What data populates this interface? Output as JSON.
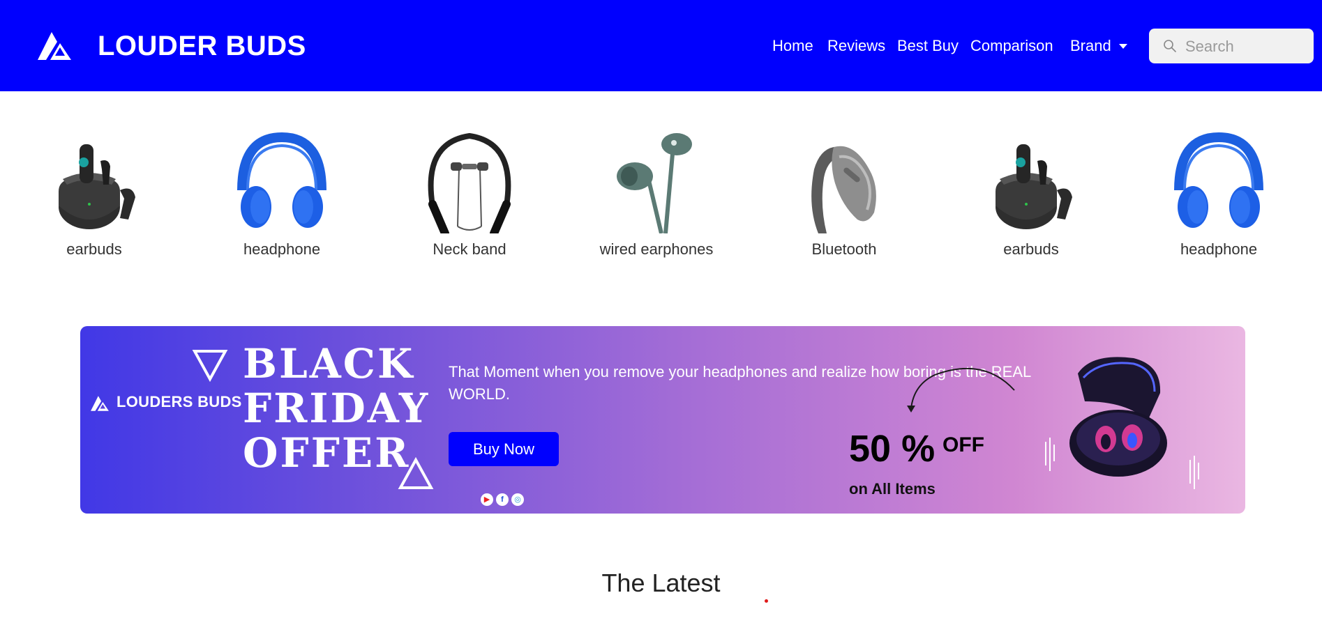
{
  "navbar": {
    "brand": "LOUDER BUDS",
    "links": [
      {
        "label": "Home",
        "icon": ""
      },
      {
        "label": "Reviews",
        "icon": ""
      },
      {
        "label": "Best Buy",
        "icon": ""
      },
      {
        "label": "Comparison",
        "icon": ""
      },
      {
        "label": "Brand",
        "icon": "chevron-down-icon"
      }
    ],
    "search": {
      "placeholder": "Search",
      "value": ""
    }
  },
  "categories": [
    {
      "label": "earbuds",
      "icon": "earbuds-icon"
    },
    {
      "label": "headphone",
      "icon": "headphone-icon"
    },
    {
      "label": "Neck band",
      "icon": "neckband-icon"
    },
    {
      "label": "wired earphones",
      "icon": "wired-earphones-icon"
    },
    {
      "label": "Bluetooth",
      "icon": "bluetooth-headset-icon"
    },
    {
      "label": "earbuds",
      "icon": "earbuds-icon"
    },
    {
      "label": "headphone",
      "icon": "headphone-icon"
    }
  ],
  "banner": {
    "brand": "LOUDERS BUDS",
    "headline": [
      "BLACK",
      "FRIDAY",
      "OFFER"
    ],
    "tagline": "That Moment when you remove your headphones and realize how boring is the REAL WORLD.",
    "cta": "Buy Now",
    "discount": "50 %",
    "discount_suffix": "OFF",
    "discount_note": "on All Items",
    "socials": [
      "youtube-icon",
      "facebook-icon",
      "instagram-icon"
    ]
  },
  "section_title": "The Latest",
  "colors": {
    "nav_bg": "#0000fe",
    "accent": "#0000fe",
    "banner_start": "#4138e6",
    "banner_end": "#eab7e2"
  }
}
